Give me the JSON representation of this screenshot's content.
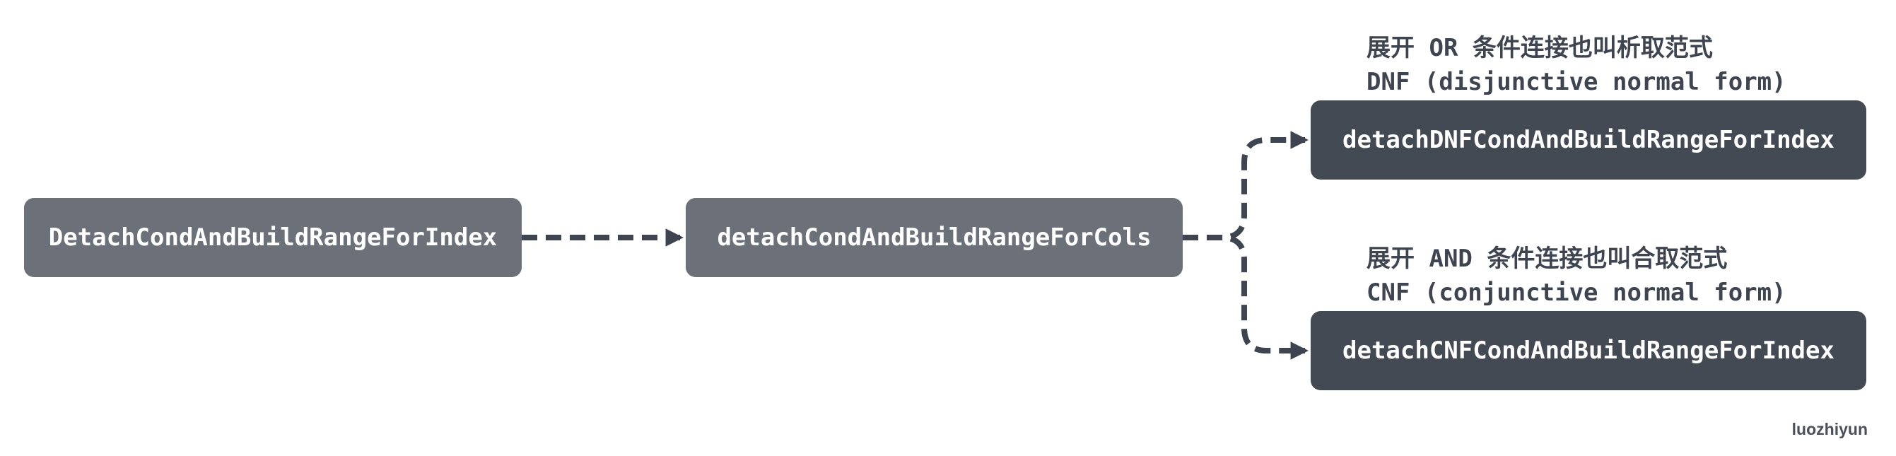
{
  "nodes": {
    "root": "DetachCondAndBuildRangeForIndex",
    "cols": "detachCondAndBuildRangeForCols",
    "dnf": "detachDNFCondAndBuildRangeForIndex",
    "cnf": "detachCNFCondAndBuildRangeForIndex"
  },
  "notes": {
    "dnf_line1": "展开 OR 条件连接也叫析取范式",
    "dnf_line2": "DNF (disjunctive normal form)",
    "cnf_line1": "展开 AND 条件连接也叫合取范式",
    "cnf_line2": "CNF (conjunctive normal form)"
  },
  "credit": "luozhiyun",
  "colors": {
    "node_light": "#6b7079",
    "node_dark": "#434a54",
    "edge": "#3f4550",
    "text": "#ffffff"
  }
}
